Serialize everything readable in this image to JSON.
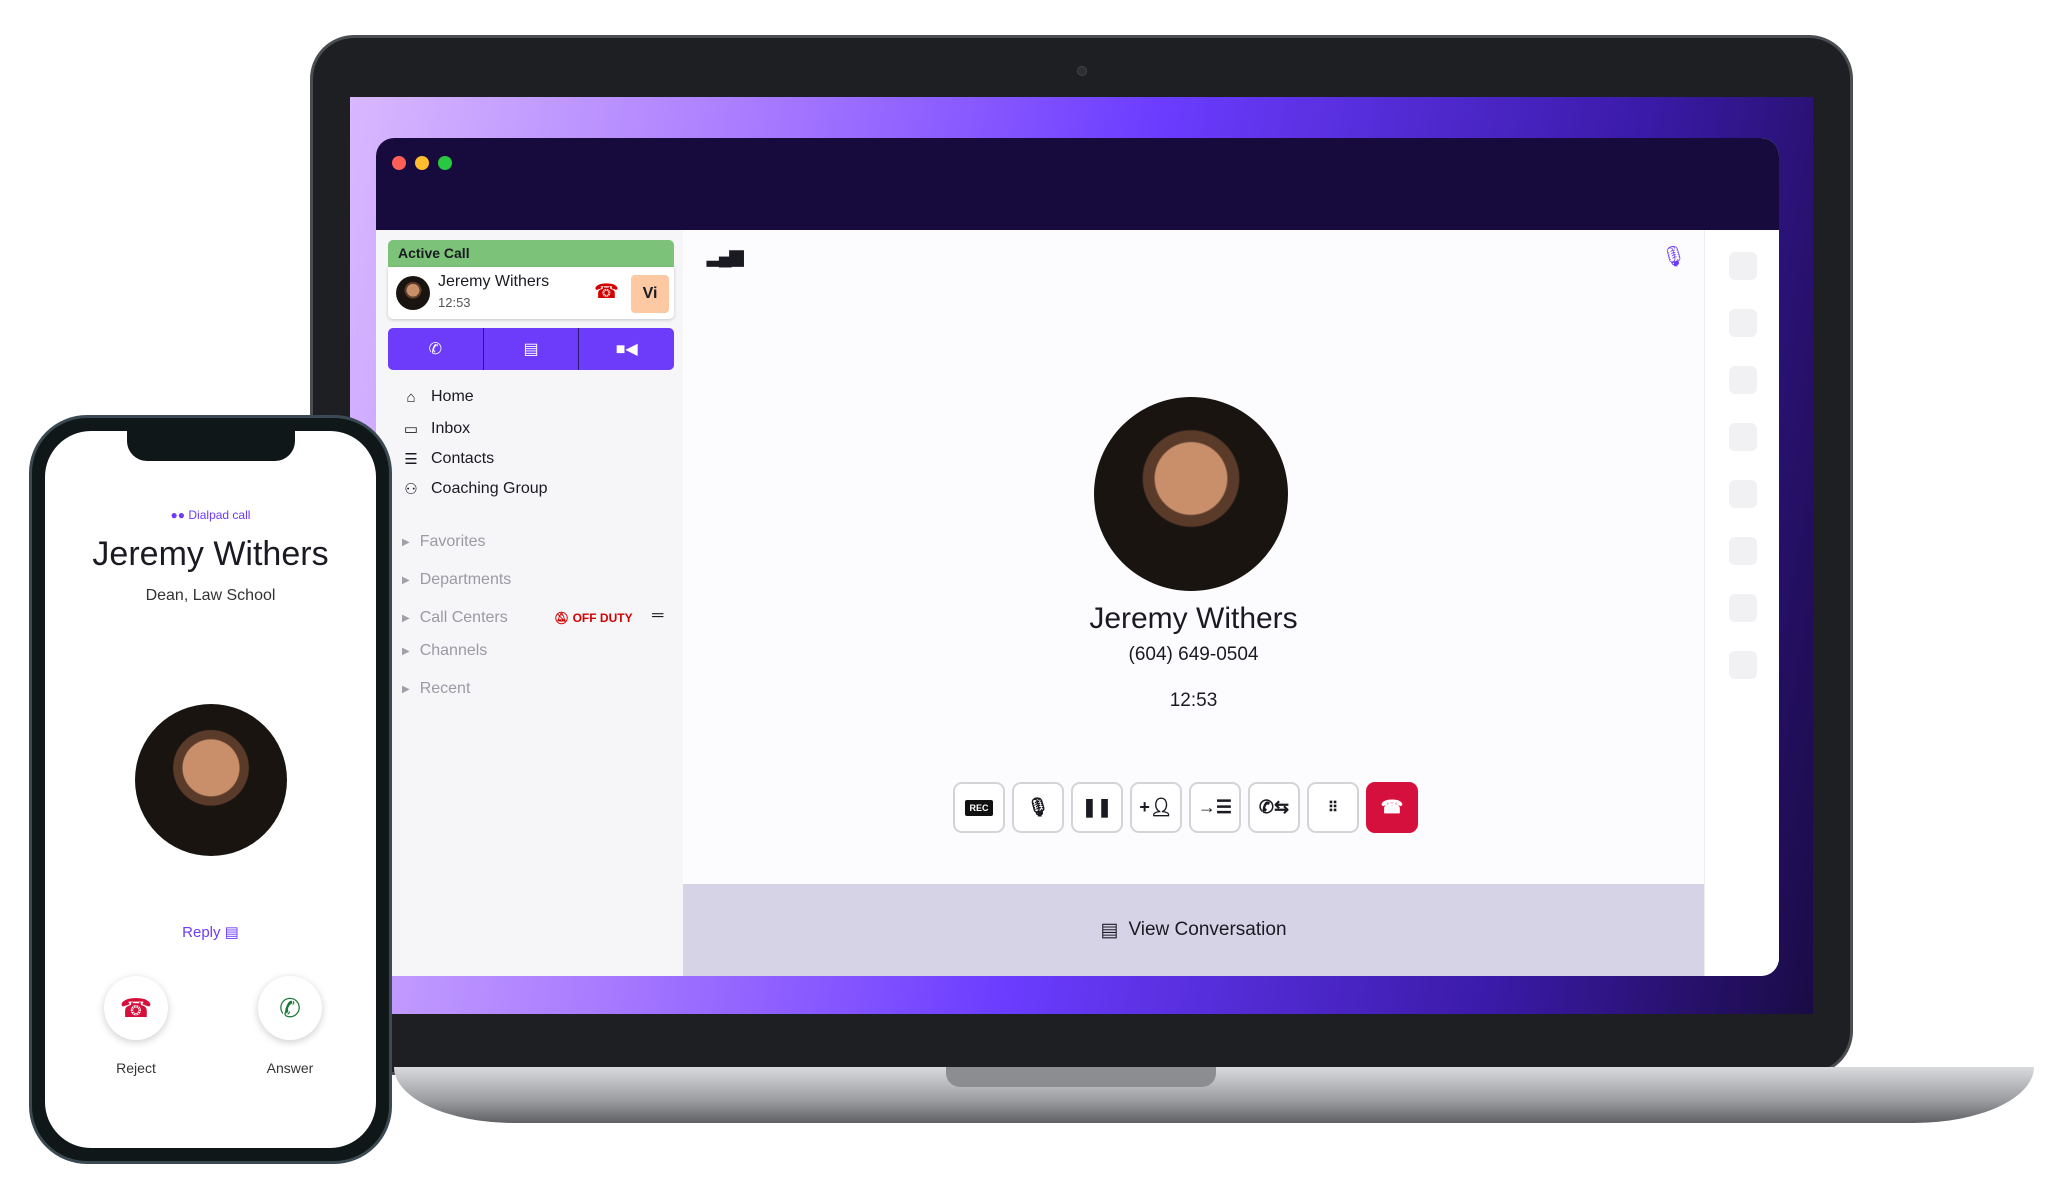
{
  "colors": {
    "accent": "#6c3cfa",
    "active_call": "#7cc379",
    "hangup": "#d6103c",
    "off_duty": "#d40000"
  },
  "sidebar": {
    "active_call": {
      "header": "Active Call",
      "name": "Jeremy Withers",
      "duration": "12:53",
      "badge": "Vi"
    },
    "quick_actions": [
      {
        "icon": "phone-icon"
      },
      {
        "icon": "message-icon"
      },
      {
        "icon": "video-icon"
      }
    ],
    "nav": [
      {
        "label": "Home",
        "icon": "home-icon"
      },
      {
        "label": "Inbox",
        "icon": "inbox-icon"
      },
      {
        "label": "Contacts",
        "icon": "contacts-icon"
      },
      {
        "label": "Coaching Group",
        "icon": "group-icon"
      }
    ],
    "groups": [
      {
        "label": "Favorites"
      },
      {
        "label": "Departments"
      },
      {
        "label": "Call Centers",
        "status": "OFF DUTY"
      },
      {
        "label": "Channels"
      },
      {
        "label": "Recent"
      }
    ]
  },
  "call": {
    "name": "Jeremy Withers",
    "number": "(604) 649-0504",
    "timer": "12:53",
    "controls": [
      {
        "name": "record",
        "label": "REC"
      },
      {
        "name": "mute"
      },
      {
        "name": "hold"
      },
      {
        "name": "add-participant"
      },
      {
        "name": "transfer"
      },
      {
        "name": "swap-call"
      },
      {
        "name": "keypad"
      },
      {
        "name": "hang-up"
      }
    ],
    "view_conversation": "View Conversation"
  },
  "phone": {
    "source": "Dialpad call",
    "name": "Jeremy Withers",
    "title": "Dean, Law School",
    "reply": "Reply",
    "reject": "Reject",
    "answer": "Answer"
  }
}
